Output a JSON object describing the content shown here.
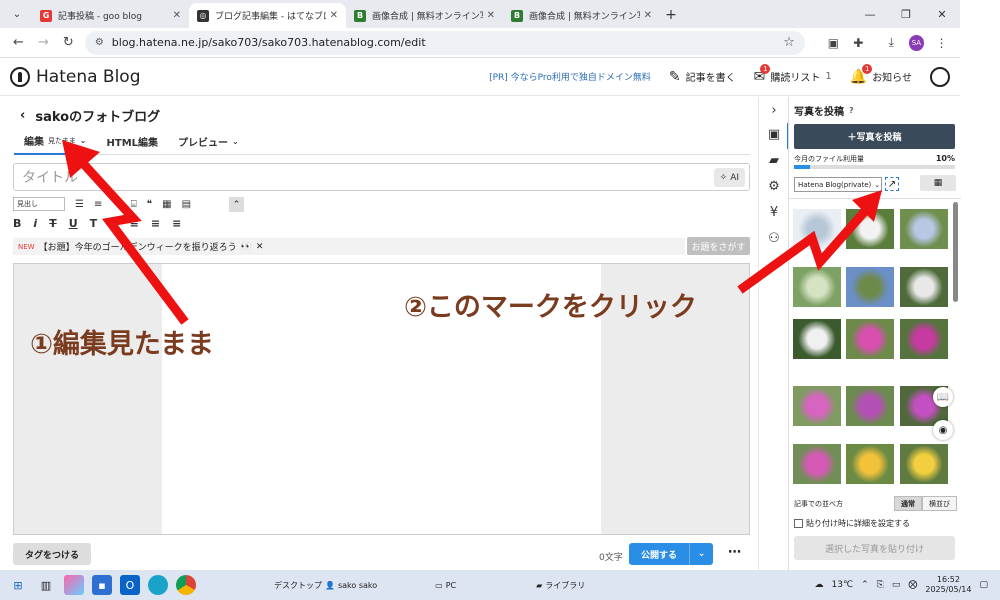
{
  "browser": {
    "tabs": [
      {
        "label": "記事投稿 - goo blog",
        "icon": "goo-favicon",
        "color": "#e53935"
      },
      {
        "label": "ブログ記事編集 - はてなブログ",
        "icon": "hatena-favicon",
        "color": "#333333",
        "active": true
      },
      {
        "label": "画像合成 | 無料オンライン写真合成",
        "icon": "image-favicon",
        "color": "#2e7d32"
      },
      {
        "label": "画像合成 | 無料オンライン写真合成",
        "icon": "image-favicon",
        "color": "#2e7d32"
      }
    ],
    "url": "blog.hatena.ne.jp/sako703/sako703.hatenablog.com/edit",
    "profile_initials": "SA"
  },
  "header": {
    "logo": "Hatena Blog",
    "promo": "[PR] 今ならPro利用で独自ドメイン無料",
    "write": "記事を書く",
    "reading": "購読リスト",
    "reading_count": "1",
    "notify": "お知らせ",
    "notify_badge": "1"
  },
  "editor": {
    "blog_title": "sakoのフォトブログ",
    "tabs": {
      "edit": "編集",
      "edit_mode": "見たまま",
      "html": "HTML編集",
      "preview": "プレビュー"
    },
    "title_placeholder": "タイトル",
    "ai_label": "AI",
    "heading_select": "見出し",
    "topic_new": "NEW",
    "topic_text": "【お題】今年のゴールデンウィークを振り返ろう",
    "topic_button": "お題をさがす",
    "tag_button": "タグをつける",
    "char_count": "0文字",
    "publish": "公開する"
  },
  "photo_panel": {
    "title": "写真を投稿",
    "post_button": "＋写真を投稿",
    "usage_label": "今月のファイル利用量",
    "usage_pct": "10%",
    "usage_fraction": 0.1,
    "folder": "Hatena Blog(private)",
    "sort_label": "記事での並べ方",
    "sort_normal": "通常",
    "sort_horizontal": "横並び",
    "detail_check": "貼り付け時に詳細を設定する",
    "paste_button": "選択した写真を貼り付け"
  },
  "annotations": {
    "step1": "①編集見たまま",
    "step2": "②このマークをクリック",
    "arrow_color": "#ee1111"
  },
  "taskbar": {
    "desktop": "デスクトップ",
    "user": "sako sako",
    "pc": "PC",
    "library": "ライブラリ",
    "temp": "13℃",
    "time": "16:52",
    "date": "2025/05/14"
  }
}
